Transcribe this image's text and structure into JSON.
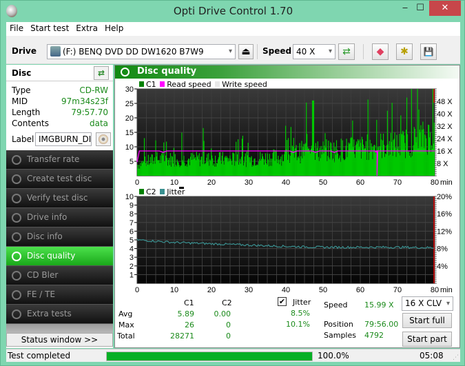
{
  "window": {
    "title": "Opti Drive Control 1.70",
    "minimize": "‒",
    "maximize": "☐",
    "close": "✕"
  },
  "menu": [
    "File",
    "Start test",
    "Extra",
    "Help"
  ],
  "toolbar": {
    "drive_label": "Drive",
    "drive_value": "(F:)   BENQ DVD DD DW1620 B7W9",
    "speed_label": "Speed",
    "speed_value": "40 X",
    "eject_icon": "⏏",
    "refresh_icon": "⇄",
    "erase_icon": "◆",
    "settings_icon": "✱",
    "save_icon": "💾"
  },
  "disc": {
    "title": "Disc",
    "rows": [
      {
        "k": "Type",
        "v": "CD-RW"
      },
      {
        "k": "MID",
        "v": "97m34s23f"
      },
      {
        "k": "Length",
        "v": "79:57.70"
      },
      {
        "k": "Contents",
        "v": "data"
      }
    ],
    "label_key": "Label",
    "label_value": "IMGBURN_DIS"
  },
  "nav": [
    {
      "label": "Transfer rate"
    },
    {
      "label": "Create test disc"
    },
    {
      "label": "Verify test disc"
    },
    {
      "label": "Drive info"
    },
    {
      "label": "Disc info"
    },
    {
      "label": "Disc quality",
      "active": true
    },
    {
      "label": "CD Bler"
    },
    {
      "label": "FE / TE"
    },
    {
      "label": "Extra tests"
    }
  ],
  "status_window_btn": "Status window >>",
  "panel": {
    "title": "Disc quality"
  },
  "legend1": {
    "c1": "C1",
    "read": "Read speed",
    "write": "Write speed"
  },
  "legend2": {
    "c2": "C2",
    "jitter": "Jitter"
  },
  "colors": {
    "c1": "#00c800",
    "read": "#ff00ff",
    "jitter": "#3a9090",
    "c2": "#008000",
    "accent": "#1aa81a"
  },
  "chart_data": [
    {
      "type": "bar",
      "title": "C1",
      "xlabel": "min",
      "xlim": [
        0,
        80
      ],
      "ylim": [
        0,
        30
      ],
      "yticks": [
        5,
        10,
        15,
        20,
        25,
        30
      ],
      "xticks": [
        0,
        10,
        20,
        30,
        40,
        50,
        60,
        70,
        80
      ],
      "right_axis": {
        "label": "X",
        "ticks": [
          "8 X",
          "16 X",
          "24 X",
          "32 X",
          "40 X",
          "48 X"
        ],
        "range": [
          0,
          56
        ]
      },
      "series": [
        {
          "name": "C1",
          "profile": [
            [
              0,
              4
            ],
            [
              5,
              6
            ],
            [
              10,
              6
            ],
            [
              20,
              6
            ],
            [
              30,
              6
            ],
            [
              40,
              7
            ],
            [
              45,
              9
            ],
            [
              47,
              13
            ],
            [
              48,
              9
            ],
            [
              50,
              9
            ],
            [
              60,
              10
            ],
            [
              65,
              11
            ],
            [
              70,
              11
            ],
            [
              75,
              13
            ],
            [
              80,
              15
            ]
          ]
        },
        {
          "name": "Read speed",
          "value_x": 16,
          "dip_at": 64.5
        }
      ]
    },
    {
      "type": "line",
      "title": "C2 / Jitter",
      "xlabel": "min",
      "xlim": [
        0,
        80
      ],
      "ylim": [
        0,
        10
      ],
      "yticks": [
        1,
        2,
        3,
        4,
        5,
        6,
        7,
        8,
        9,
        10
      ],
      "xticks": [
        0,
        10,
        20,
        30,
        40,
        50,
        60,
        70,
        80
      ],
      "right_axis": {
        "label": "%",
        "ticks": [
          "4%",
          "8%",
          "12%",
          "16%",
          "20%"
        ],
        "range": [
          0,
          20
        ]
      },
      "series": [
        {
          "name": "C2",
          "values": [
            0
          ]
        },
        {
          "name": "Jitter",
          "profile": [
            [
              0,
              10.0
            ],
            [
              10,
              9.4
            ],
            [
              20,
              9.1
            ],
            [
              30,
              8.8
            ],
            [
              40,
              8.5
            ],
            [
              50,
              8.3
            ],
            [
              60,
              8.3
            ],
            [
              70,
              8.3
            ],
            [
              80,
              8.2
            ]
          ]
        }
      ]
    }
  ],
  "stats": {
    "h_c1": "C1",
    "h_c2": "C2",
    "h_jitter": "Jitter",
    "jitter_checked": true,
    "rows": [
      {
        "k": "Avg",
        "c1": "5.89",
        "c2": "0.00",
        "j": "8.5%"
      },
      {
        "k": "Max",
        "c1": "26",
        "c2": "0",
        "j": "10.1%"
      },
      {
        "k": "Total",
        "c1": "28271",
        "c2": "0",
        "j": ""
      }
    ]
  },
  "info": {
    "speed_k": "Speed",
    "speed_v": "15.99 X",
    "pos_k": "Position",
    "pos_v": "79:56.00",
    "samples_k": "Samples",
    "samples_v": "4792",
    "mode": "16 X CLV"
  },
  "buttons": {
    "start_full": "Start full",
    "start_part": "Start part"
  },
  "status": {
    "text": "Test completed",
    "progress": 100,
    "progress_text": "100.0%",
    "time": "05:08"
  }
}
